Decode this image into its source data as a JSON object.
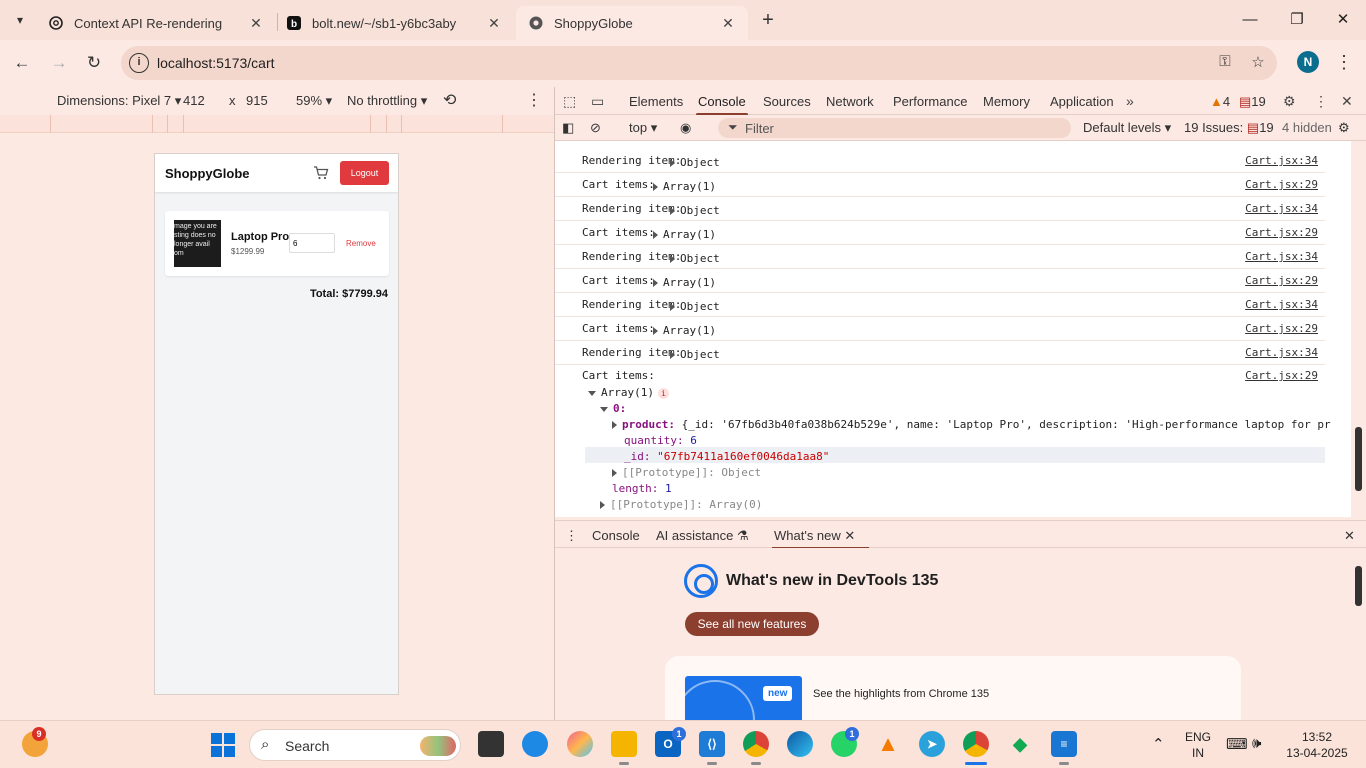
{
  "browser": {
    "tabs": [
      {
        "title": "Context API Re-rendering",
        "icon": "openai-icon",
        "active": false
      },
      {
        "title": "bolt.new/~/sb1-y6bc3aby",
        "icon": "bolt-icon",
        "active": false
      },
      {
        "title": "ShoppyGlobe",
        "icon": "globe-icon",
        "active": true
      }
    ],
    "url": "localhost:5173/cart",
    "profile_initial": "N"
  },
  "device_toolbar": {
    "dimensions_label": "Dimensions: Pixel 7",
    "width": "412",
    "times": "x",
    "height": "915",
    "zoom": "59%",
    "throttling": "No throttling"
  },
  "app": {
    "brand": "ShoppyGlobe",
    "logout_label": "Logout",
    "cart_item": {
      "image_text": "mage you are sting does no longer avail om",
      "name": "Laptop Pro",
      "price": "$1299.99",
      "quantity": "6",
      "remove_label": "Remove"
    },
    "total": "Total: $7799.94"
  },
  "devtools": {
    "tabs": [
      "Elements",
      "Console",
      "Sources",
      "Network",
      "Performance",
      "Memory",
      "Application"
    ],
    "active_tab": "Console",
    "warnings_count": "4",
    "issues_count": "19",
    "console_toolbar": {
      "context": "top",
      "filter_placeholder": "Filter",
      "levels": "Default levels",
      "issues_label": "19 Issues:",
      "issues_msgs": "19",
      "hidden_label": "4 hidden"
    },
    "logs": [
      {
        "label": "Rendering item:",
        "value": "Object",
        "source": "Cart.jsx:34"
      },
      {
        "label": "Cart items:",
        "value": "Array(1)",
        "source": "Cart.jsx:29"
      },
      {
        "label": "Rendering item:",
        "value": "Object",
        "source": "Cart.jsx:34"
      },
      {
        "label": "Cart items:",
        "value": "Array(1)",
        "source": "Cart.jsx:29"
      },
      {
        "label": "Rendering item:",
        "value": "Object",
        "source": "Cart.jsx:34"
      },
      {
        "label": "Cart items:",
        "value": "Array(1)",
        "source": "Cart.jsx:29"
      },
      {
        "label": "Rendering item:",
        "value": "Object",
        "source": "Cart.jsx:34"
      },
      {
        "label": "Cart items:",
        "value": "Array(1)",
        "source": "Cart.jsx:29"
      },
      {
        "label": "Rendering item:",
        "value": "Object",
        "source": "Cart.jsx:34"
      }
    ],
    "expanded": {
      "label": "Cart items:",
      "source": "Cart.jsx:29",
      "array": "Array(1)",
      "index": "0:",
      "product_key": "product:",
      "product_preview": "{_id: '67fb6d3b40fa038b624b529e', name: 'Laptop Pro', description: 'High-performance laptop for pr",
      "quantity_key": "quantity:",
      "quantity_value": "6",
      "id_key": "_id:",
      "id_value": "\"67fb7411a160ef0046da1aa8\"",
      "proto_obj": "[[Prototype]]: Object",
      "length_key": "length:",
      "length_value": "1",
      "proto_arr": "[[Prototype]]: Array(0)"
    },
    "drawer": {
      "tabs": [
        "Console",
        "AI assistance",
        "What's new"
      ],
      "whats_new_title": "What's new in DevTools 135",
      "see_all": "See all new features",
      "new_badge": "new",
      "highlights": "See the highlights from Chrome 135"
    }
  },
  "taskbar": {
    "weather_badge": "9",
    "search_placeholder": "Search",
    "outlook_badge": "1",
    "whatsapp_badge": "1",
    "lang_top": "ENG",
    "lang_bottom": "IN",
    "time": "13:52",
    "date": "13-04-2025"
  }
}
